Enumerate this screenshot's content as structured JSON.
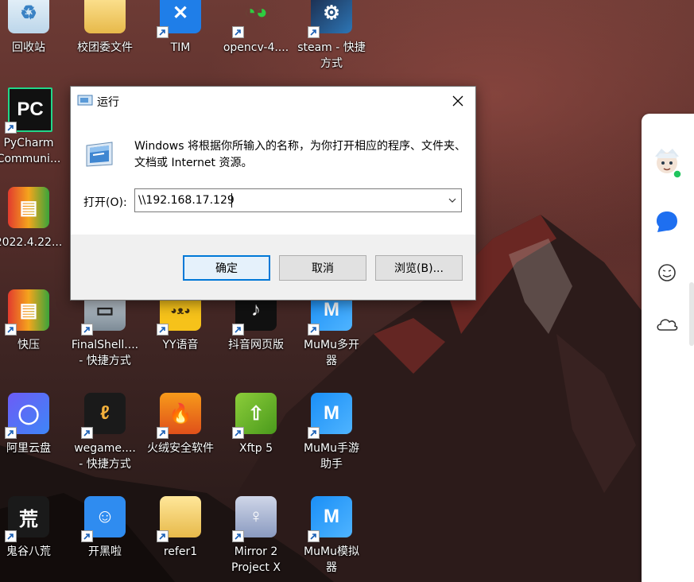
{
  "desktop": {
    "icons": [
      {
        "label": "回收站",
        "icon": "recycle-bin-icon"
      },
      {
        "label": "校团委文件",
        "icon": "folder-icon"
      },
      {
        "label": "TIM",
        "icon": "tim-icon"
      },
      {
        "label": "opencv-4....",
        "icon": "opencv-icon"
      },
      {
        "label": "steam - 快捷",
        "label2": "方式",
        "icon": "steam-icon"
      },
      {
        "label": "PyCharm",
        "label2": "Communi...",
        "icon": "pycharm-icon"
      },
      {
        "label": "2022.4.22...",
        "icon": "archive-icon"
      },
      {
        "label": "快压",
        "icon": "kuaiya-icon"
      },
      {
        "label": "FinalShell....",
        "label2": "- 快捷方式",
        "icon": "finalshell-icon"
      },
      {
        "label": "YY语音",
        "icon": "yy-icon"
      },
      {
        "label": "抖音网页版",
        "icon": "douyin-icon"
      },
      {
        "label": "MuMu多开",
        "label2": "器",
        "icon": "mumu-icon"
      },
      {
        "label": "阿里云盘",
        "icon": "aliyun-drive-icon"
      },
      {
        "label": "wegame....",
        "label2": "- 快捷方式",
        "icon": "wegame-icon"
      },
      {
        "label": "火绒安全软件",
        "icon": "huorong-icon"
      },
      {
        "label": "Xftp 5",
        "icon": "xftp-icon"
      },
      {
        "label": "MuMu手游",
        "label2": "助手",
        "icon": "mumu-icon"
      },
      {
        "label": "鬼谷八荒",
        "icon": "guigu-icon"
      },
      {
        "label": "开黑啦",
        "icon": "kaiheila-icon"
      },
      {
        "label": "refer1",
        "icon": "folder-icon"
      },
      {
        "label": "Mirror 2",
        "label2": "Project X",
        "icon": "mirror2-icon"
      },
      {
        "label": "MuMu模拟",
        "label2": "器",
        "icon": "mumu-icon"
      }
    ]
  },
  "run_dialog": {
    "title": "运行",
    "description": "Windows 将根据你所输入的名称，为你打开相应的程序、文件夹、文档或 Internet 资源。",
    "open_label": "打开(O):",
    "input_value": "\\\\192.168.17.129",
    "ok_label": "确定",
    "cancel_label": "取消",
    "browse_label": "浏览(B)..."
  },
  "side_panel": {
    "items": [
      "avatar",
      "chat-bubble-icon",
      "smiley-icon",
      "cloud-icon"
    ]
  },
  "colors": {
    "accent": "#0078d7",
    "online": "#22c55e",
    "bubble": "#1e6ff0"
  }
}
